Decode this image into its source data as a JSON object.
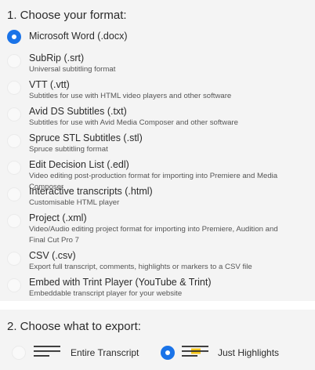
{
  "format_section": {
    "heading": "1. Choose your format:",
    "options": [
      {
        "title": "Microsoft Word (.docx)",
        "desc": "",
        "selected": true
      },
      {
        "title": "SubRip (.srt)",
        "desc": "Universal subtitling format",
        "selected": false
      },
      {
        "title": "VTT (.vtt)",
        "desc": "Subtitles for use with HTML video players and other software",
        "selected": false
      },
      {
        "title": "Avid DS Subtitles (.txt)",
        "desc": "Subtitles for use with Avid Media Composer and other software",
        "selected": false
      },
      {
        "title": "Spruce STL Subtitles (.stl)",
        "desc": "Spruce subtitling format",
        "selected": false
      },
      {
        "title": "Edit Decision List (.edl)",
        "desc": "Video editing post-production format for importing into Premiere and Media Composer",
        "selected": false
      },
      {
        "title": "Interactive transcripts (.html)",
        "desc": "Customisable HTML player",
        "selected": false
      },
      {
        "title": "Project (.xml)",
        "desc": "Video/Audio editing project format for importing into Premiere, Audition and Final Cut Pro 7",
        "selected": false
      },
      {
        "title": "CSV (.csv)",
        "desc": "Export full transcript, comments, highlights or markers to a CSV file",
        "selected": false
      },
      {
        "title": "Embed with Trint Player (YouTube & Trint)",
        "desc": "Embeddable transcript player for your website",
        "selected": false
      }
    ]
  },
  "export_section": {
    "heading": "2. Choose what to export:",
    "options": [
      {
        "label": "Entire Transcript",
        "icon": "text-lines-icon",
        "selected": false
      },
      {
        "label": "Just Highlights",
        "icon": "highlighted-lines-icon",
        "selected": true
      }
    ]
  },
  "colors": {
    "accent": "#1a73e8",
    "highlight": "#f5c518",
    "panel_bg": "#f4f4f4"
  }
}
